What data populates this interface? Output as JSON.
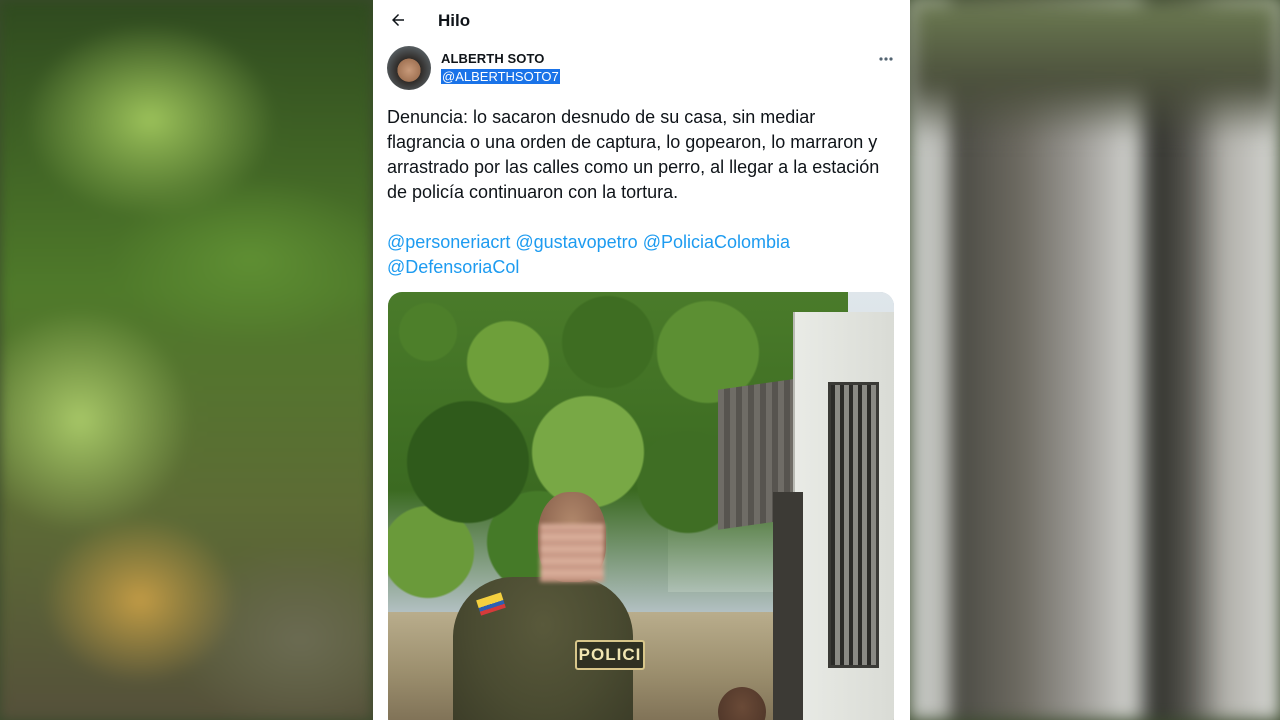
{
  "header": {
    "title": "Hilo"
  },
  "author": {
    "name": "ALBERTH SOTO",
    "handle": "@ALBERTHSOTO7"
  },
  "tweet": {
    "text": "Denuncia: lo sacaron desnudo de su casa, sin mediar flagrancia o una orden de captura, lo gopearon, lo marraron y arrastrado por las calles como un perro, al llegar a la estación de policía continuaron con la tortura.",
    "mentions": [
      "@personeriacrt",
      "@gustavopetro",
      "@PoliciaColombia",
      "@DefensoriaCol"
    ]
  },
  "photo": {
    "badge_text": "POLICI"
  },
  "colors": {
    "link": "#1d9bf0",
    "text": "#0f1419",
    "selection": "#1a73e8"
  },
  "icons": {
    "back": "arrow-left-icon",
    "more": "more-horizontal-icon"
  }
}
